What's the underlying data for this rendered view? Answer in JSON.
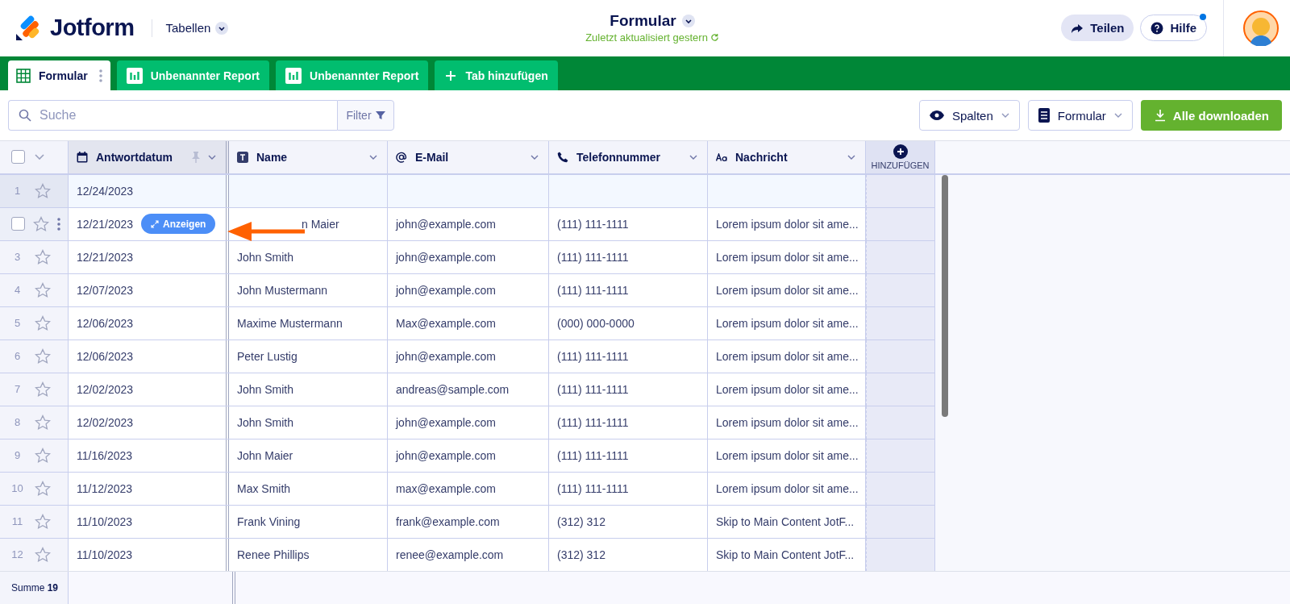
{
  "header": {
    "logo": "Jotform",
    "nav": "Tabellen",
    "title": "Formular",
    "subtitle": "Zuletzt aktualisiert gestern",
    "share": "Teilen",
    "help": "Hilfe",
    "help_notification": true
  },
  "tabs": [
    {
      "label": "Formular",
      "kind": "table",
      "selected": true
    },
    {
      "label": "Unbenannter Report",
      "kind": "report",
      "selected": false
    },
    {
      "label": "Unbenannter Report",
      "kind": "report",
      "selected": false
    },
    {
      "label": "Tab hinzufügen",
      "kind": "add",
      "selected": false
    }
  ],
  "toolbar": {
    "search_placeholder": "Suche",
    "filter": "Filter",
    "columns": "Spalten",
    "form": "Formular",
    "download": "Alle downloaden"
  },
  "table": {
    "all_checked": false,
    "columns": [
      {
        "label": "Antwortdatum",
        "kind": "date",
        "pinned": true
      },
      {
        "label": "Name",
        "kind": "text",
        "pinned": false
      },
      {
        "label": "E-Mail",
        "kind": "email",
        "pinned": false
      },
      {
        "label": "Telefonnummer",
        "kind": "phone",
        "pinned": false
      },
      {
        "label": "Nachricht",
        "kind": "textarea",
        "pinned": false
      }
    ],
    "add_column": "HINZUFÜGEN",
    "rows": [
      {
        "number": "1",
        "cells": [
          "12/24/2023",
          "",
          "",
          "",
          ""
        ],
        "selected": true,
        "hovered": false,
        "starred": false
      },
      {
        "cells": [
          "12/21/2023",
          "n Maier",
          "john@example.com",
          "(111) 111-1111",
          "Lorem ipsum dolor sit ame..."
        ],
        "selected": false,
        "hovered": true,
        "checked": false,
        "starred": false,
        "action": "Anzeigen"
      },
      {
        "number": "3",
        "cells": [
          "12/21/2023",
          "John Smith",
          "john@example.com",
          "(111) 111-1111",
          "Lorem ipsum dolor sit ame..."
        ],
        "selected": false,
        "hovered": false,
        "starred": false
      },
      {
        "number": "4",
        "cells": [
          "12/07/2023",
          "John Mustermann",
          "john@example.com",
          "(111) 111-1111",
          "Lorem ipsum dolor sit ame..."
        ],
        "selected": false,
        "hovered": false,
        "starred": false
      },
      {
        "number": "5",
        "cells": [
          "12/06/2023",
          "Maxime Mustermann",
          "Max@example.com",
          "(000) 000-0000",
          "Lorem ipsum dolor sit ame..."
        ],
        "selected": false,
        "hovered": false,
        "starred": false
      },
      {
        "number": "6",
        "cells": [
          "12/06/2023",
          "Peter Lustig",
          "john@example.com",
          "(111) 111-1111",
          "Lorem ipsum dolor sit ame..."
        ],
        "selected": false,
        "hovered": false,
        "starred": false
      },
      {
        "number": "7",
        "cells": [
          "12/02/2023",
          "John Smith",
          "andreas@sample.com",
          "(111) 111-1111",
          "Lorem ipsum dolor sit ame..."
        ],
        "selected": false,
        "hovered": false,
        "starred": false
      },
      {
        "number": "8",
        "cells": [
          "12/02/2023",
          "John Smith",
          "john@example.com",
          "(111) 111-1111",
          "Lorem ipsum dolor sit ame..."
        ],
        "selected": false,
        "hovered": false,
        "starred": false
      },
      {
        "number": "9",
        "cells": [
          "11/16/2023",
          "John Maier",
          "john@example.com",
          "(111) 111-1111",
          "Lorem ipsum dolor sit ame..."
        ],
        "selected": false,
        "hovered": false,
        "starred": false
      },
      {
        "number": "10",
        "cells": [
          "11/12/2023",
          "Max Smith",
          "max@example.com",
          "(111) 111-1111",
          "Lorem ipsum dolor sit ame..."
        ],
        "selected": false,
        "hovered": false,
        "starred": false
      },
      {
        "number": "11",
        "cells": [
          "11/10/2023",
          "Frank Vining",
          "frank@example.com",
          "(312) 312",
          "Skip to Main Content JotF..."
        ],
        "selected": false,
        "hovered": false,
        "starred": false
      },
      {
        "number": "12",
        "cells": [
          "11/10/2023",
          "Renee Phillips",
          "renee@example.com",
          "(312) 312",
          "Skip to Main Content JotF..."
        ],
        "selected": false,
        "hovered": false,
        "starred": false
      }
    ],
    "footer": "Summe **19**"
  }
}
